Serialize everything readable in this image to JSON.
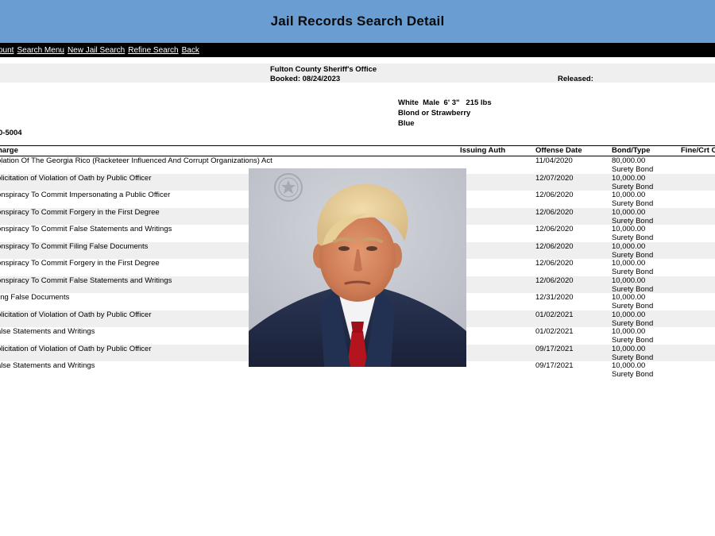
{
  "header": {
    "title": "Jail Records Search Detail"
  },
  "nav": {
    "links": [
      "count",
      "Search Menu",
      "New Jail Search",
      "Refine Search",
      "Back"
    ]
  },
  "record": {
    "agency": "Fulton County Sheriff's Office",
    "booked": "Booked: 08/24/2023",
    "released": "Released:",
    "physical": "White  Male  6' 3\"   215 lbs",
    "hair": "Blond or Strawberry",
    "eyes": "Blue",
    "id_fragment": "0-5004"
  },
  "table": {
    "columns": [
      "harge",
      "Issuing Auth",
      "Offense Date",
      "Bond/Type",
      "Fine/Crt C"
    ],
    "rows": [
      {
        "charge": "olation Of The Georgia Rico (Racketeer Influenced And Corrupt Organizations) Act",
        "date": "11/04/2020",
        "bond": "80,000.00",
        "type": "Surety Bond"
      },
      {
        "charge": "olicitation of Violation of Oath by Public Officer",
        "date": "12/07/2020",
        "bond": "10,000.00",
        "type": "Surety Bond"
      },
      {
        "charge": "onspiracy To Commit Impersonating a Public Officer",
        "date": "12/06/2020",
        "bond": "10,000.00",
        "type": "Surety Bond"
      },
      {
        "charge": "onspiracy To Commit Forgery in the First Degree",
        "date": "12/06/2020",
        "bond": "10,000.00",
        "type": "Surety Bond"
      },
      {
        "charge": "onspiracy To Commit False Statements and Writings",
        "date": "12/06/2020",
        "bond": "10,000.00",
        "type": "Surety Bond"
      },
      {
        "charge": "onspiracy To Commit Filing False Documents",
        "date": "12/06/2020",
        "bond": "10,000.00",
        "type": "Surety Bond"
      },
      {
        "charge": "onspiracy To Commit Forgery in the First Degree",
        "date": "12/06/2020",
        "bond": "10,000.00",
        "type": "Surety Bond"
      },
      {
        "charge": "onspiracy To Commit False Statements and Writings",
        "date": "12/06/2020",
        "bond": "10,000.00",
        "type": "Surety Bond"
      },
      {
        "charge": "ling False Documents",
        "date": "12/31/2020",
        "bond": "10,000.00",
        "type": "Surety Bond"
      },
      {
        "charge": "olicitation of Violation of Oath by Public Officer",
        "date": "01/02/2021",
        "bond": "10,000.00",
        "type": "Surety Bond"
      },
      {
        "charge": "alse Statements and Writings",
        "date": "01/02/2021",
        "bond": "10,000.00",
        "type": "Surety Bond"
      },
      {
        "charge": "olicitation of Violation of Oath by Public Officer",
        "date": "09/17/2021",
        "bond": "10,000.00",
        "type": "Surety Bond"
      },
      {
        "charge": "alse Statements and Writings",
        "date": "09/17/2021",
        "bond": "10,000.00",
        "type": "Surety Bond"
      }
    ]
  },
  "colors": {
    "header_bg": "#6a9ed2",
    "nav_bg": "#000000",
    "row_shade": "#efefef"
  }
}
